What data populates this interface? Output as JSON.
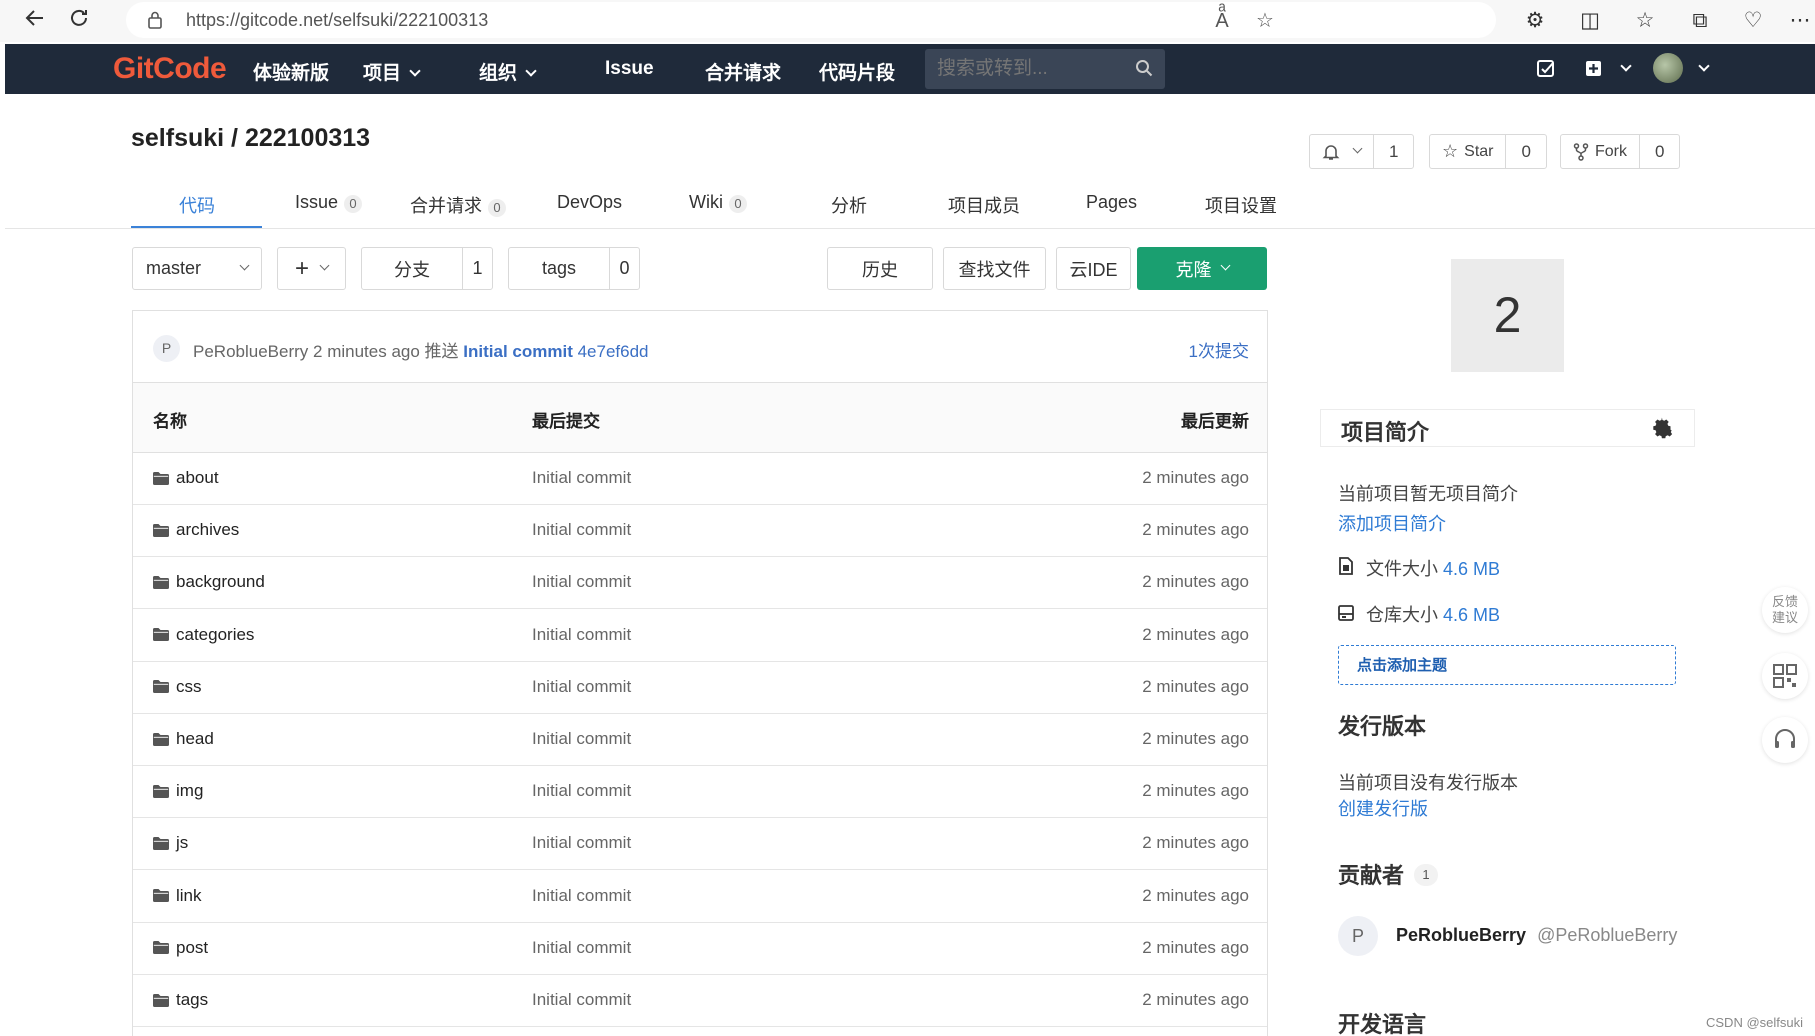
{
  "browser": {
    "url": "https://gitcode.net/selfsuki/222100313"
  },
  "nav": {
    "logo": "GitCode",
    "items": [
      "体验新版",
      "项目",
      "组织",
      "Issue",
      "合并请求",
      "代码片段"
    ],
    "search_placeholder": "搜索或转到..."
  },
  "repo": {
    "title": "selfsuki / 222100313",
    "watch_count": "1",
    "star_label": "Star",
    "star_count": "0",
    "fork_label": "Fork",
    "fork_count": "0"
  },
  "tabs": [
    {
      "label": "代码",
      "badge": ""
    },
    {
      "label": "Issue",
      "badge": "0"
    },
    {
      "label": "合并请求",
      "badge": "0"
    },
    {
      "label": "DevOps",
      "badge": ""
    },
    {
      "label": "Wiki",
      "badge": "0"
    },
    {
      "label": "分析",
      "badge": ""
    },
    {
      "label": "项目成员",
      "badge": ""
    },
    {
      "label": "Pages",
      "badge": ""
    },
    {
      "label": "项目设置",
      "badge": ""
    }
  ],
  "toolbar": {
    "branch": "master",
    "branches_label": "分支",
    "branches_count": "1",
    "tags_label": "tags",
    "tags_count": "0",
    "history": "历史",
    "find_file": "查找文件",
    "web_ide": "云IDE",
    "clone": "克隆"
  },
  "last_commit": {
    "avatar": "P",
    "author": "PeRoblueBerry",
    "time": "2 minutes ago",
    "action": "推送",
    "message": "Initial commit",
    "sha": "4e7ef6dd",
    "commit_count": "1次提交"
  },
  "table": {
    "headers": {
      "name": "名称",
      "commit": "最后提交",
      "updated": "最后更新"
    },
    "rows": [
      {
        "name": "about",
        "commit": "Initial commit",
        "time": "2 minutes ago"
      },
      {
        "name": "archives",
        "commit": "Initial commit",
        "time": "2 minutes ago"
      },
      {
        "name": "background",
        "commit": "Initial commit",
        "time": "2 minutes ago"
      },
      {
        "name": "categories",
        "commit": "Initial commit",
        "time": "2 minutes ago"
      },
      {
        "name": "css",
        "commit": "Initial commit",
        "time": "2 minutes ago"
      },
      {
        "name": "head",
        "commit": "Initial commit",
        "time": "2 minutes ago"
      },
      {
        "name": "img",
        "commit": "Initial commit",
        "time": "2 minutes ago"
      },
      {
        "name": "js",
        "commit": "Initial commit",
        "time": "2 minutes ago"
      },
      {
        "name": "link",
        "commit": "Initial commit",
        "time": "2 minutes ago"
      },
      {
        "name": "post",
        "commit": "Initial commit",
        "time": "2 minutes ago"
      },
      {
        "name": "tags",
        "commit": "Initial commit",
        "time": "2 minutes ago"
      }
    ]
  },
  "sidebar": {
    "project_number": "2",
    "intro_title": "项目简介",
    "no_intro": "当前项目暂无项目简介",
    "add_intro": "添加项目简介",
    "file_size_label": "文件大小",
    "file_size": "4.6 MB",
    "repo_size_label": "仓库大小",
    "repo_size": "4.6 MB",
    "add_topic": "点击添加主题",
    "release_title": "发行版本",
    "no_release": "当前项目没有发行版本",
    "create_release": "创建发行版",
    "contributors_title": "贡献者",
    "contributors_count": "1",
    "contributor_avatar": "P",
    "contributor_name": "PeRoblueBerry",
    "contributor_handle": "@PeRoblueBerry",
    "language_title": "开发语言"
  },
  "float": {
    "feedback": "反馈建议"
  },
  "watermark": "CSDN @selfsuki",
  "colors": {
    "nav_bg": "#1f2a3a",
    "logo": "#ef5a3b",
    "accent": "#3b82d8",
    "clone_btn": "#1a9f70"
  }
}
